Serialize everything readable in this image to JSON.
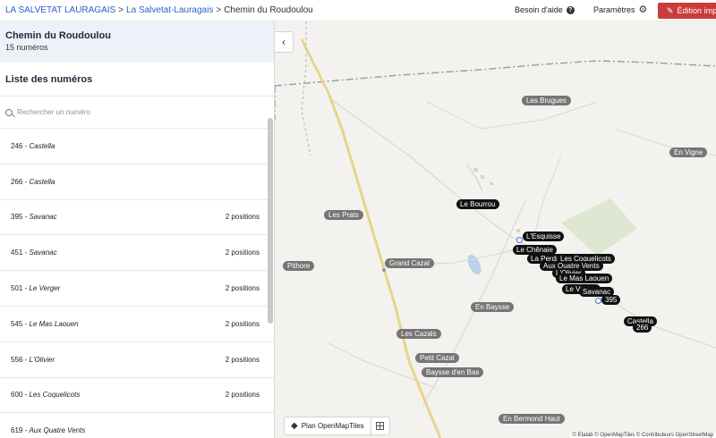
{
  "breadcrumb": {
    "commune_link": "LA SALVETAT LAURAGAIS",
    "sep1": ">",
    "locality_link": "La Salvetat-Lauragais",
    "sep2": ">",
    "current": "Chemin du Roudoulou"
  },
  "header": {
    "help_label": "Besoin d'aide",
    "help_icon": "?",
    "settings_label": "Paramètres",
    "settings_icon": "⚙",
    "edit_label": "Édition impo",
    "edit_icon": "✎"
  },
  "sidebar": {
    "street_name": "Chemin du Roudoulou",
    "street_count": "15 numéros",
    "list_title": "Liste des numéros",
    "search_placeholder": "Rechercher un numéro",
    "rows": [
      {
        "number": "246",
        "sep": " - ",
        "locality": "Castella",
        "positions": ""
      },
      {
        "number": "266",
        "sep": " - ",
        "locality": "Castella",
        "positions": ""
      },
      {
        "number": "395",
        "sep": " - ",
        "locality": "Savanac",
        "positions": "2 positions"
      },
      {
        "number": "451",
        "sep": " - ",
        "locality": "Savanac",
        "positions": "2 positions"
      },
      {
        "number": "501",
        "sep": " - ",
        "locality": "Le Verger",
        "positions": "2 positions"
      },
      {
        "number": "545",
        "sep": " - ",
        "locality": "Le Mas Laouen",
        "positions": "2 positions"
      },
      {
        "number": "556",
        "sep": " - ",
        "locality": "L'Olivier",
        "positions": "2 positions"
      },
      {
        "number": "600",
        "sep": " - ",
        "locality": "Les Coquelicots",
        "positions": "2 positions"
      },
      {
        "number": "619",
        "sep": " - ",
        "locality": "Aux Quatre Vents",
        "positions": ""
      }
    ]
  },
  "map": {
    "collapse_icon": "‹",
    "places": [
      "Les Brugues",
      "En Vigne",
      "Les Prats",
      "Pithore",
      "Grand Cazal",
      "En Baysse",
      "Les Cazals",
      "Petit Cazal",
      "Baysse d'en Bas",
      "En Bermond Haut"
    ],
    "addresses": [
      "Le Bourrou",
      "L'Esquisse",
      "Le Chênaie",
      "La Perdrière",
      "Les Coquelicots",
      "Aux Quatre Vents",
      "L'Olivier",
      "Le Mas Laouen",
      "Le Verger",
      "Savanac",
      "395",
      "Castella",
      "266"
    ],
    "style_switch_label": "Plan OpenMapTiles",
    "layers_icon": "◆",
    "attribution": "© Etalab © OpenMapTiles © Contributeurs OpenStreetMap"
  }
}
